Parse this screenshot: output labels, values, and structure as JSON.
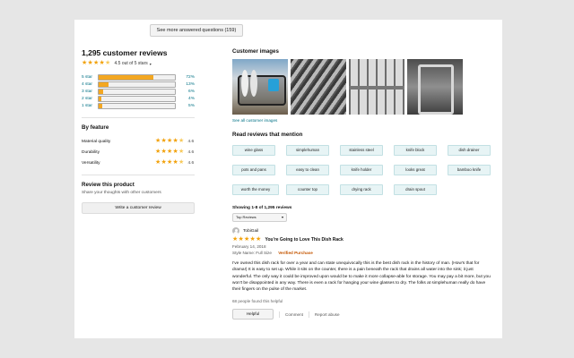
{
  "top": {
    "see_more_label": "See more answered questions (159)"
  },
  "summary": {
    "title": "1,295 customer reviews",
    "rating_text": "4.5 out of 5 stars",
    "rating_value": 4.5,
    "histogram": [
      {
        "label": "5 star",
        "percent": "72%",
        "fraction": 0.72
      },
      {
        "label": "4 star",
        "percent": "13%",
        "fraction": 0.13
      },
      {
        "label": "3 star",
        "percent": "6%",
        "fraction": 0.06
      },
      {
        "label": "2 star",
        "percent": "4%",
        "fraction": 0.04
      },
      {
        "label": "1 star",
        "percent": "5%",
        "fraction": 0.05
      }
    ]
  },
  "by_feature": {
    "title": "By feature",
    "items": [
      {
        "name": "Material quality",
        "score": "4.6"
      },
      {
        "name": "Durability",
        "score": "4.6"
      },
      {
        "name": "Versatility",
        "score": "4.6"
      }
    ]
  },
  "review_product": {
    "title": "Review this product",
    "subtitle": "Share your thoughts with other customers",
    "button_label": "Write a customer review"
  },
  "customer_images": {
    "title": "Customer images",
    "link_label": "See all customer images"
  },
  "mentions": {
    "title": "Read reviews that mention",
    "chips": [
      "wine glass",
      "simplehuman",
      "stainless steel",
      "knife block",
      "dish drainer",
      "pots and pans",
      "easy to clean",
      "knife holder",
      "looks great",
      "bamboo knife",
      "worth the money",
      "counter top",
      "drying rack",
      "drain spout"
    ]
  },
  "reviews": {
    "showing": "Showing 1-8 of 1,295 reviews",
    "sort_selected": "Top Reviews",
    "first": {
      "author": "TobiGail",
      "headline": "You're Going to Love This Dish Rack",
      "date": "February 14, 2018",
      "style": "Style Name: Full Size",
      "verified": "Verified Purchase",
      "body": "I've owned this dish rack for over a year and can state unequivocally this is the best dish rack in the history of man. (How's that for drama!) It is easy to set up. While it sits on the counter, there is a pain beneath the rack that drains all water into the sink; it just wonderful. The only way it could be improved upon would be to make it more collapse-able for storage. You may pay a bit more, but you won't be disappointed in any way. There is even a rack for hanging your wine glasses to dry. The folks at simplehuman really do have their fingers on the pulse of the market.",
      "helpful_count": "68 people found this helpful",
      "helpful_label": "Helpful",
      "comment_label": "Comment",
      "report_label": "Report abuse"
    }
  },
  "colors": {
    "star": "#f2a20c",
    "link": "#007185",
    "chip_bg": "#e7f4f5"
  }
}
